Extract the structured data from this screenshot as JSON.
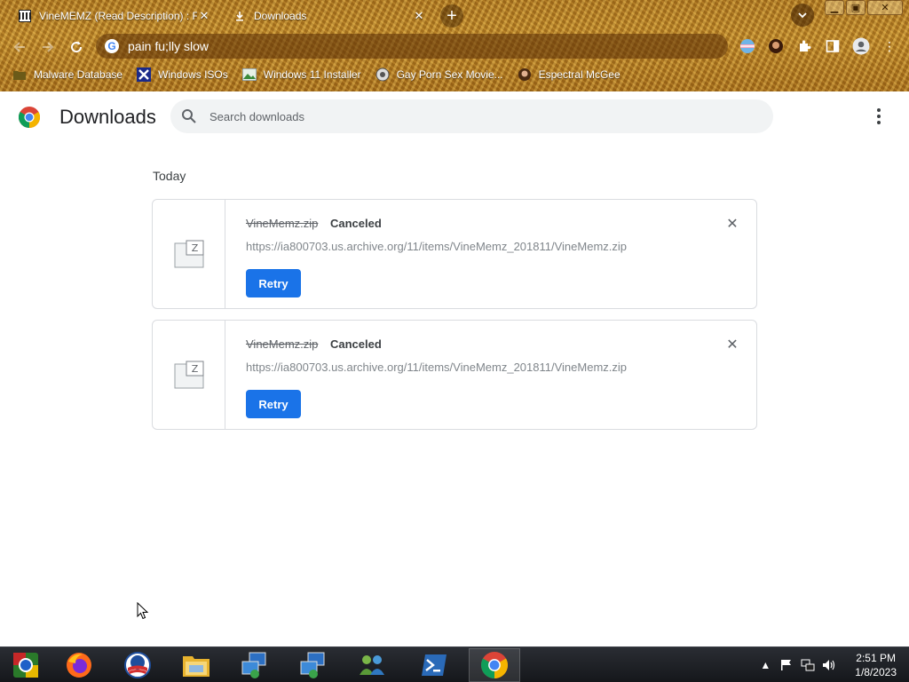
{
  "browser": {
    "tabs": [
      {
        "title": "VineMEMZ (Read Description) : F",
        "icon": "archive-icon",
        "active": true
      },
      {
        "title": "Downloads",
        "icon": "download-icon",
        "active": false
      }
    ],
    "new_tab_label": "+",
    "address": "pain fu;lly slow",
    "bookmarks": [
      {
        "label": "Malware Database",
        "icon": "folder-icon"
      },
      {
        "label": "Windows ISOs",
        "icon": "x-icon"
      },
      {
        "label": "Windows 11 Installer",
        "icon": "image-icon"
      },
      {
        "label": "Gay Porn Sex Movie...",
        "icon": "page-icon"
      },
      {
        "label": "Espectral McGee",
        "icon": "avatar-icon"
      }
    ]
  },
  "page": {
    "title": "Downloads",
    "search_placeholder": "Search downloads",
    "section_label": "Today",
    "downloads": [
      {
        "filename": "VineMemz.zip",
        "status": "Canceled",
        "url": "https://ia800703.us.archive.org/11/items/VineMemz_201811/VineMemz.zip",
        "action": "Retry",
        "file_icon": "zip-file-icon"
      },
      {
        "filename": "VineMemz.zip",
        "status": "Canceled",
        "url": "https://ia800703.us.archive.org/11/items/VineMemz_201811/VineMemz.zip",
        "action": "Retry",
        "file_icon": "zip-file-icon"
      }
    ]
  },
  "taskbar": {
    "apps": [
      {
        "name": "chrome-alt-icon"
      },
      {
        "name": "firefox-icon"
      },
      {
        "name": "obama-logo-icon"
      },
      {
        "name": "file-explorer-icon"
      },
      {
        "name": "remote-desktop-icon"
      },
      {
        "name": "remote-desktop-icon-2"
      },
      {
        "name": "network-users-icon"
      },
      {
        "name": "powershell-icon"
      },
      {
        "name": "chrome-icon",
        "active": true
      }
    ],
    "time": "2:51 PM",
    "date": "1/8/2023"
  },
  "colors": {
    "accent": "#1a73e8",
    "theme_brown": "#b07a22",
    "taskbar": "#1b1d22"
  }
}
